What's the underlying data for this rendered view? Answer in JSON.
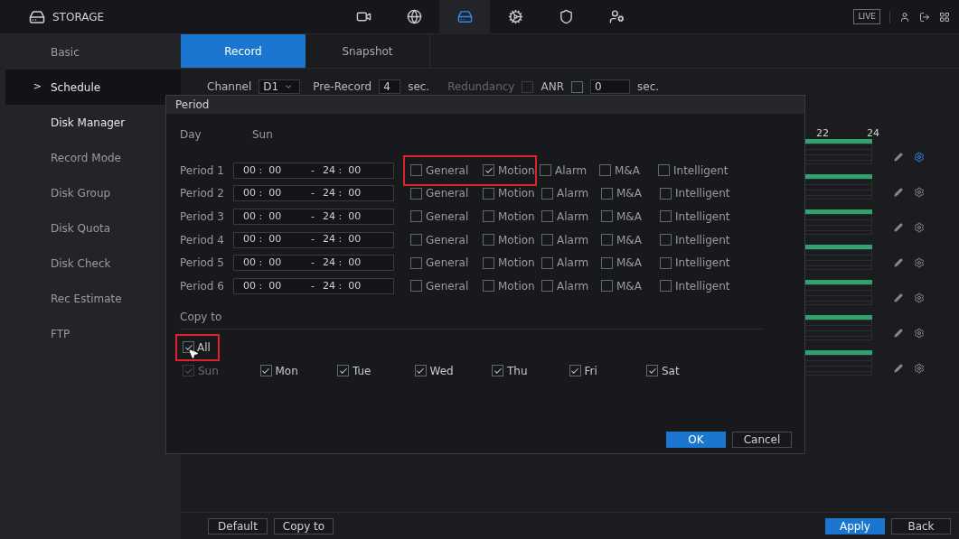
{
  "header": {
    "title": "STORAGE",
    "nav": [
      {
        "kind": "camera",
        "selected": false
      },
      {
        "kind": "network",
        "selected": false
      },
      {
        "kind": "storage",
        "selected": true
      },
      {
        "kind": "settings",
        "selected": false
      },
      {
        "kind": "shield",
        "selected": false
      },
      {
        "kind": "account",
        "selected": false
      }
    ],
    "live": "LIVE"
  },
  "sidebar": {
    "items": [
      {
        "label": "Basic",
        "selected": false,
        "highlighted": false
      },
      {
        "label": "Schedule",
        "selected": true,
        "highlighted": false,
        "marker": ">"
      },
      {
        "label": "Disk Manager",
        "selected": false,
        "highlighted": true
      },
      {
        "label": "Record Mode",
        "selected": false,
        "highlighted": false
      },
      {
        "label": "Disk Group",
        "selected": false,
        "highlighted": false
      },
      {
        "label": "Disk Quota",
        "selected": false,
        "highlighted": false
      },
      {
        "label": "Disk Check",
        "selected": false,
        "highlighted": false
      },
      {
        "label": "Rec Estimate",
        "selected": false,
        "highlighted": false
      },
      {
        "label": "FTP",
        "selected": false,
        "highlighted": false
      }
    ]
  },
  "tabs": [
    {
      "label": "Record",
      "selected": true
    },
    {
      "label": "Snapshot",
      "selected": false
    }
  ],
  "channel_bar": {
    "channel_label": "Channel",
    "channel": "D1",
    "prerecord_label": "Pre-Record",
    "prerecord": "4",
    "prerecord_unit": "sec.",
    "redundancy": {
      "label": "Redundancy",
      "checked": false,
      "disabled": true
    },
    "anr": {
      "label": "ANR",
      "checked": false,
      "disabled": false
    },
    "anr_value": "0",
    "anr_unit": "sec."
  },
  "schedule": {
    "hour_labels": [
      "22",
      "24"
    ],
    "days": [
      {
        "selected": true
      },
      {
        "selected": false
      },
      {
        "selected": false
      },
      {
        "selected": false
      },
      {
        "selected": false
      },
      {
        "selected": false
      },
      {
        "selected": false
      }
    ]
  },
  "dialog": {
    "title": "Period",
    "day_label": "Day",
    "day": "Sun",
    "periods": [
      {
        "label": "Period 1",
        "start": "00 :  00",
        "dash": "-",
        "end": "24 :  00",
        "option_groups": [
          {
            "framed": true,
            "options": [
              {
                "label": "General",
                "checked": false
              },
              {
                "label": "Motion",
                "checked": true
              }
            ]
          },
          {
            "framed": false,
            "options": [
              {
                "label": "Alarm",
                "checked": false
              },
              {
                "label": "M&A",
                "checked": false
              },
              {
                "label": "Intelligent",
                "checked": false
              }
            ]
          }
        ]
      },
      {
        "label": "Period 2",
        "start": "00 :  00",
        "dash": "-",
        "end": "24 :  00",
        "option_groups": [
          {
            "framed": false,
            "options": [
              {
                "label": "General",
                "checked": false
              },
              {
                "label": "Motion",
                "checked": false
              },
              {
                "label": "Alarm",
                "checked": false
              },
              {
                "label": "M&A",
                "checked": false
              },
              {
                "label": "Intelligent",
                "checked": false
              }
            ]
          }
        ]
      },
      {
        "label": "Period 3",
        "start": "00 :  00",
        "dash": "-",
        "end": "24 :  00",
        "option_groups": [
          {
            "framed": false,
            "options": [
              {
                "label": "General",
                "checked": false
              },
              {
                "label": "Motion",
                "checked": false
              },
              {
                "label": "Alarm",
                "checked": false
              },
              {
                "label": "M&A",
                "checked": false
              },
              {
                "label": "Intelligent",
                "checked": false
              }
            ]
          }
        ]
      },
      {
        "label": "Period 4",
        "start": "00 :  00",
        "dash": "-",
        "end": "24 :  00",
        "option_groups": [
          {
            "framed": false,
            "options": [
              {
                "label": "General",
                "checked": false
              },
              {
                "label": "Motion",
                "checked": false
              },
              {
                "label": "Alarm",
                "checked": false
              },
              {
                "label": "M&A",
                "checked": false
              },
              {
                "label": "Intelligent",
                "checked": false
              }
            ]
          }
        ]
      },
      {
        "label": "Period 5",
        "start": "00 :  00",
        "dash": "-",
        "end": "24 :  00",
        "option_groups": [
          {
            "framed": false,
            "options": [
              {
                "label": "General",
                "checked": false
              },
              {
                "label": "Motion",
                "checked": false
              },
              {
                "label": "Alarm",
                "checked": false
              },
              {
                "label": "M&A",
                "checked": false
              },
              {
                "label": "Intelligent",
                "checked": false
              }
            ]
          }
        ]
      },
      {
        "label": "Period 6",
        "start": "00 :  00",
        "dash": "-",
        "end": "24 :  00",
        "option_groups": [
          {
            "framed": false,
            "options": [
              {
                "label": "General",
                "checked": false
              },
              {
                "label": "Motion",
                "checked": false
              },
              {
                "label": "Alarm",
                "checked": false
              },
              {
                "label": "M&A",
                "checked": false
              },
              {
                "label": "Intelligent",
                "checked": false
              }
            ]
          }
        ]
      }
    ],
    "copy_to": {
      "label": "Copy to",
      "all": {
        "label": "All",
        "checked": true,
        "framed": true
      },
      "days": [
        {
          "label": "Sun",
          "checked": true,
          "disabled": true
        },
        {
          "label": "Mon",
          "checked": true,
          "disabled": false
        },
        {
          "label": "Tue",
          "checked": true,
          "disabled": false
        },
        {
          "label": "Wed",
          "checked": true,
          "disabled": false
        },
        {
          "label": "Thu",
          "checked": true,
          "disabled": false
        },
        {
          "label": "Fri",
          "checked": true,
          "disabled": false
        },
        {
          "label": "Sat",
          "checked": true,
          "disabled": false
        }
      ]
    },
    "buttons": [
      {
        "label": "OK",
        "kind": "primary"
      },
      {
        "label": "Cancel",
        "kind": "plain"
      }
    ]
  },
  "footer": {
    "left": [
      {
        "label": "Default",
        "kind": "plain"
      },
      {
        "label": "Copy to",
        "kind": "plain"
      }
    ],
    "right": [
      {
        "label": "Apply",
        "kind": "primary"
      },
      {
        "label": "Back",
        "kind": "plain"
      }
    ]
  }
}
